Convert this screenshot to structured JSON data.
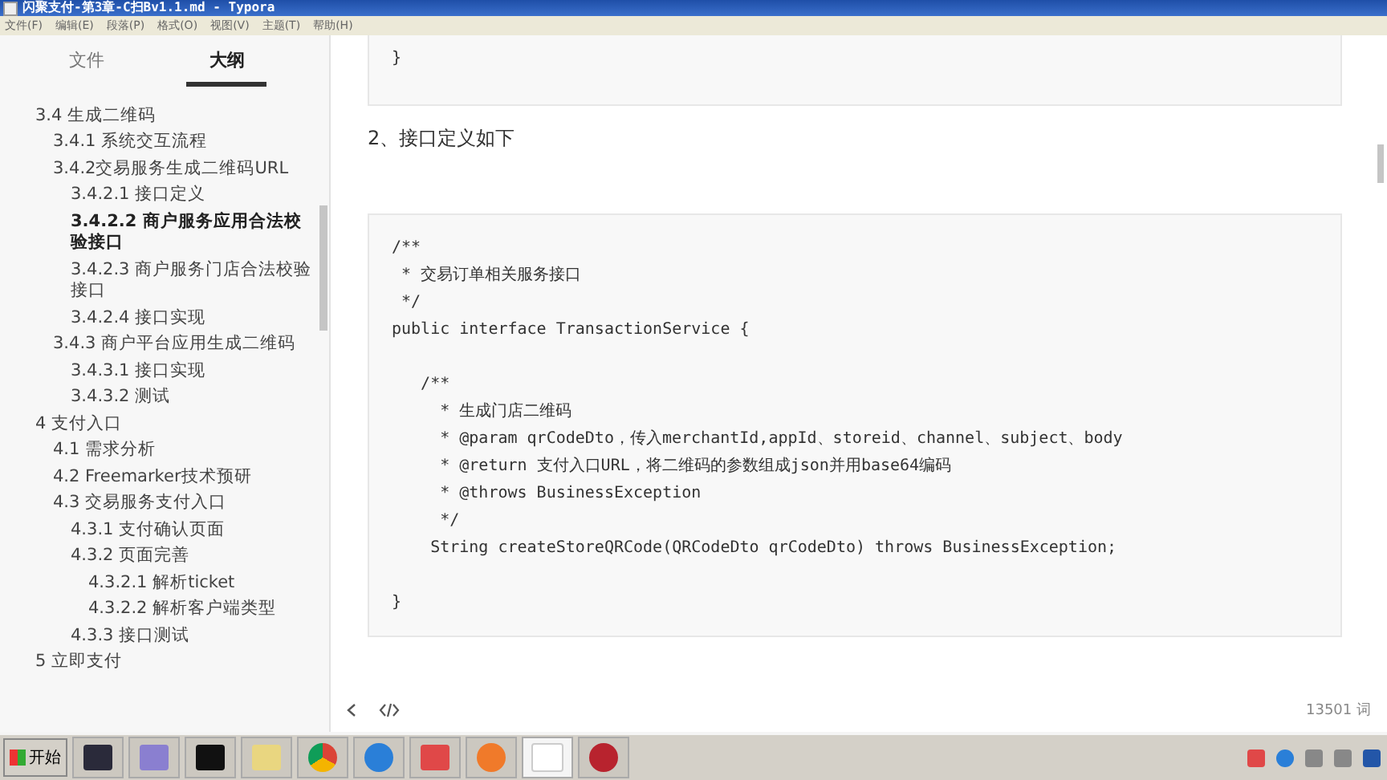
{
  "window": {
    "title": "闪聚支付-第3章-C扫Bv1.1.md - Typora"
  },
  "menu": [
    "文件(F)",
    "编辑(E)",
    "段落(P)",
    "格式(O)",
    "视图(V)",
    "主题(T)",
    "帮助(H)"
  ],
  "sidebar": {
    "tabs": [
      {
        "label": "文件",
        "selected": false
      },
      {
        "label": "大纲",
        "selected": true
      }
    ],
    "outline": [
      {
        "label": "3.4 生成二维码",
        "selected": false,
        "children": [
          {
            "label": "3.4.1 系统交互流程",
            "selected": false
          },
          {
            "label": "3.4.2交易服务生成二维码URL",
            "selected": false,
            "children": [
              {
                "label": "3.4.2.1 接口定义",
                "selected": false
              },
              {
                "label": "3.4.2.2 商户服务应用合法校验接口",
                "selected": true
              },
              {
                "label": "3.4.2.3 商户服务门店合法校验接口",
                "selected": false
              },
              {
                "label": "3.4.2.4 接口实现",
                "selected": false
              }
            ]
          },
          {
            "label": "3.4.3 商户平台应用生成二维码",
            "selected": false,
            "children": [
              {
                "label": "3.4.3.1 接口实现",
                "selected": false
              },
              {
                "label": "3.4.3.2 测试",
                "selected": false
              }
            ]
          }
        ]
      },
      {
        "label": "4 支付入口",
        "selected": false,
        "children": [
          {
            "label": "4.1 需求分析",
            "selected": false
          },
          {
            "label": "4.2 Freemarker技术预研",
            "selected": false
          },
          {
            "label": "4.3 交易服务支付入口",
            "selected": false,
            "children": [
              {
                "label": "4.3.1 支付确认页面",
                "selected": false
              },
              {
                "label": "4.3.2 页面完善",
                "selected": false,
                "children": [
                  {
                    "label": "4.3.2.1 解析ticket",
                    "selected": false
                  },
                  {
                    "label": "4.3.2.2 解析客户端类型",
                    "selected": false
                  }
                ]
              },
              {
                "label": "4.3.3 接口测试",
                "selected": false
              }
            ]
          }
        ]
      },
      {
        "label": "5 立即支付",
        "selected": false
      }
    ]
  },
  "content": [
    {
      "kind": "code",
      "groups": [
        [
          "}"
        ]
      ]
    },
    {
      "kind": "heading",
      "text": "2、接口定义如下"
    },
    {
      "kind": "code",
      "groups": [
        [
          "/**",
          " * 交易订单相关服务接口",
          " */",
          "public interface TransactionService {"
        ],
        [
          "   /**",
          "     * 生成门店二维码",
          "     * @param qrCodeDto，传入merchantId,appId、storeid、channel、subject、body",
          "     * @return 支付入口URL，将二维码的参数组成json并用base64编码",
          "     * @throws BusinessException",
          "     */",
          "    String createStoreQRCode(QRCodeDto qrCodeDto) throws BusinessException;"
        ],
        [
          "}"
        ]
      ]
    }
  ],
  "footer": {
    "word_count": "13501 词"
  },
  "taskbar": {
    "start": "开始"
  }
}
